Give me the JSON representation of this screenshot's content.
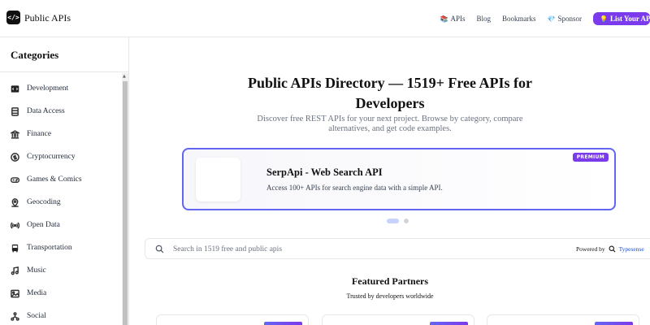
{
  "header": {
    "logo_glyph": "</>",
    "brand": "Public APIs",
    "nav": [
      {
        "icon": "📚",
        "label": "APIs"
      },
      {
        "icon": "",
        "label": "Blog"
      },
      {
        "icon": "",
        "label": "Bookmarks"
      },
      {
        "icon": "💎",
        "label": "Sponsor"
      }
    ],
    "cta": {
      "icon": "💡",
      "label": "List Your API"
    }
  },
  "sidebar": {
    "title": "Categories",
    "items": [
      {
        "icon": "code-icon",
        "label": "Development"
      },
      {
        "icon": "database-icon",
        "label": "Data Access"
      },
      {
        "icon": "bank-icon",
        "label": "Finance"
      },
      {
        "icon": "coin-icon",
        "label": "Cryptocurrency"
      },
      {
        "icon": "gamepad-icon",
        "label": "Games & Comics"
      },
      {
        "icon": "map-pin-icon",
        "label": "Geocoding"
      },
      {
        "icon": "signal-icon",
        "label": "Open Data"
      },
      {
        "icon": "bus-icon",
        "label": "Transportation"
      },
      {
        "icon": "music-icon",
        "label": "Music"
      },
      {
        "icon": "image-icon",
        "label": "Media"
      },
      {
        "icon": "social-icon",
        "label": "Social"
      }
    ]
  },
  "main": {
    "title": "Public APIs Directory — 1519+ Free APIs for Developers",
    "subtitle": "Discover free REST APIs for your next project. Browse by category, compare alternatives, and get code examples.",
    "promo": {
      "badge": "PREMIUM",
      "name": "SerpApi - Web Search API",
      "description": "Access 100+ APIs for search engine data with a simple API."
    },
    "search": {
      "placeholder": "Search in 1519 free and public apis",
      "powered_by": "Powered by",
      "provider": "Typesense"
    },
    "featured": {
      "title": "Featured Partners",
      "subtitle": "Trusted by developers worldwide"
    }
  },
  "colors": {
    "accent": "#7c3aed",
    "promo_border": "#6366f1"
  }
}
